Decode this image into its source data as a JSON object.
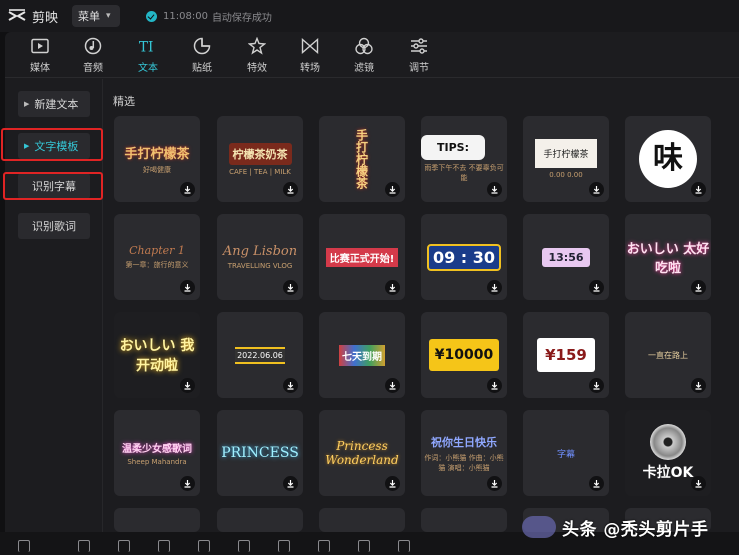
{
  "app": {
    "name": "剪映",
    "menu_label": "菜单",
    "autosave_time": "11:08:00",
    "autosave_text": "自动保存成功"
  },
  "toolbar": [
    {
      "label": "媒体",
      "icon": "media-icon"
    },
    {
      "label": "音频",
      "icon": "audio-icon"
    },
    {
      "label": "文本",
      "icon": "text-icon",
      "active": true
    },
    {
      "label": "贴纸",
      "icon": "sticker-icon"
    },
    {
      "label": "特效",
      "icon": "effects-icon"
    },
    {
      "label": "转场",
      "icon": "transition-icon"
    },
    {
      "label": "滤镜",
      "icon": "filter-icon"
    },
    {
      "label": "调节",
      "icon": "adjust-icon"
    }
  ],
  "sidebar": {
    "items": [
      {
        "label": "新建文本"
      },
      {
        "label": "文字模板",
        "active": true
      },
      {
        "label": "识别字幕"
      },
      {
        "label": "识别歌词"
      }
    ]
  },
  "content": {
    "section_title": "精选",
    "tiles": [
      {
        "text": "手打柠檬茶",
        "sub": "好喝健康"
      },
      {
        "text": "柠檬茶奶茶",
        "sub": "CAFE | TEA | MILK"
      },
      {
        "text": "手打柠檬茶"
      },
      {
        "text": "TIPS:",
        "sub": "雨季下午不去 不要辜负可能"
      },
      {
        "text": "手打柠檬茶",
        "sub": "0.00 0.00"
      },
      {
        "text": "味"
      },
      {
        "text": "Chapter 1",
        "sub": "第一章：旅行的意义"
      },
      {
        "text": "Ang Lisbon",
        "sub": "TRAVELLING VLOG"
      },
      {
        "text": "比赛正式开始!"
      },
      {
        "text": "09 : 30"
      },
      {
        "text": "13:56"
      },
      {
        "text": "おいしい 太好吃啦"
      },
      {
        "text": "おいしい 我开动啦"
      },
      {
        "text": "2022.06.06"
      },
      {
        "text": "七天到期"
      },
      {
        "text": "¥10000"
      },
      {
        "text": "¥159"
      },
      {
        "text": "一直在路上"
      },
      {
        "text": "温柔少女感歌词",
        "sub": "Sheep Mahandra"
      },
      {
        "text": "PRINCESS"
      },
      {
        "text": "Princess Wonderland"
      },
      {
        "text": "祝你生日快乐",
        "sub": "作词：小熊猫 作曲：小熊猫 演唱：小熊猫"
      },
      {
        "text": "字幕"
      },
      {
        "text": "卡拉OK"
      }
    ]
  },
  "watermark": {
    "text": "头条 @秃头剪片手"
  },
  "colors": {
    "accent": "#35c6d6",
    "highlight_box": "#e02424",
    "panel_bg": "#1c1c1f",
    "tile_bg": "#2b2b2f"
  }
}
